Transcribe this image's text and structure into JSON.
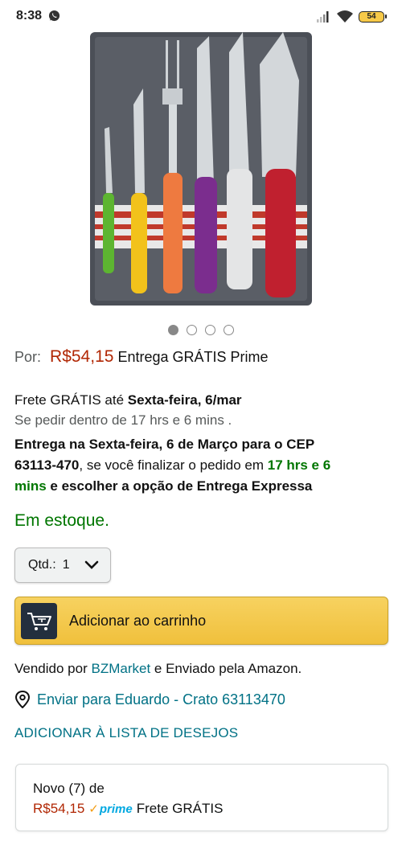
{
  "status_bar": {
    "time": "8:38",
    "battery": "54"
  },
  "product": {
    "image_icon": "knife-set-photo",
    "carousel_dots": 4,
    "active_dot": 0
  },
  "price": {
    "prefix": "Por:",
    "value": "R$54,15",
    "shipping": "Entrega GRÁTIS Prime"
  },
  "delivery": {
    "frete_prefix": "Frete GRÁTIS até",
    "frete_date": "Sexta-feira, 6/mar",
    "se_pedir": "Se pedir dentro de 17 hrs e 6 mins .",
    "delivery_part1": "Entrega na Sexta-feira, 6 de Março para o CEP",
    "delivery_cep": "63113-470",
    "delivery_part2": ", se você finalizar o pedido em ",
    "delivery_time_a": "17 hrs e 6",
    "delivery_time_b": "mins",
    "delivery_part3": " e escolher a opção de Entrega Expressa"
  },
  "stock": "Em estoque.",
  "quantity": {
    "label": "Qtd.:",
    "value": "1"
  },
  "add_to_cart": {
    "label": "Adicionar ao carrinho"
  },
  "seller": {
    "prefix": "Vendido por",
    "name": "BZMarket",
    "suffix": "e Enviado pela Amazon."
  },
  "ship_to": "Enviar para Eduardo - Crato 63113470",
  "wishlist": "ADICIONAR À LISTA DE DESEJOS",
  "offer": {
    "title": "Novo (7) de",
    "price": "R$54,15",
    "prime": "prime",
    "shipping": "Frete GRÁTIS"
  },
  "colors": {
    "price_red": "#b12704",
    "link_teal": "#007185",
    "stock_green": "#007600",
    "cart_yellow": "#f0c03c"
  }
}
